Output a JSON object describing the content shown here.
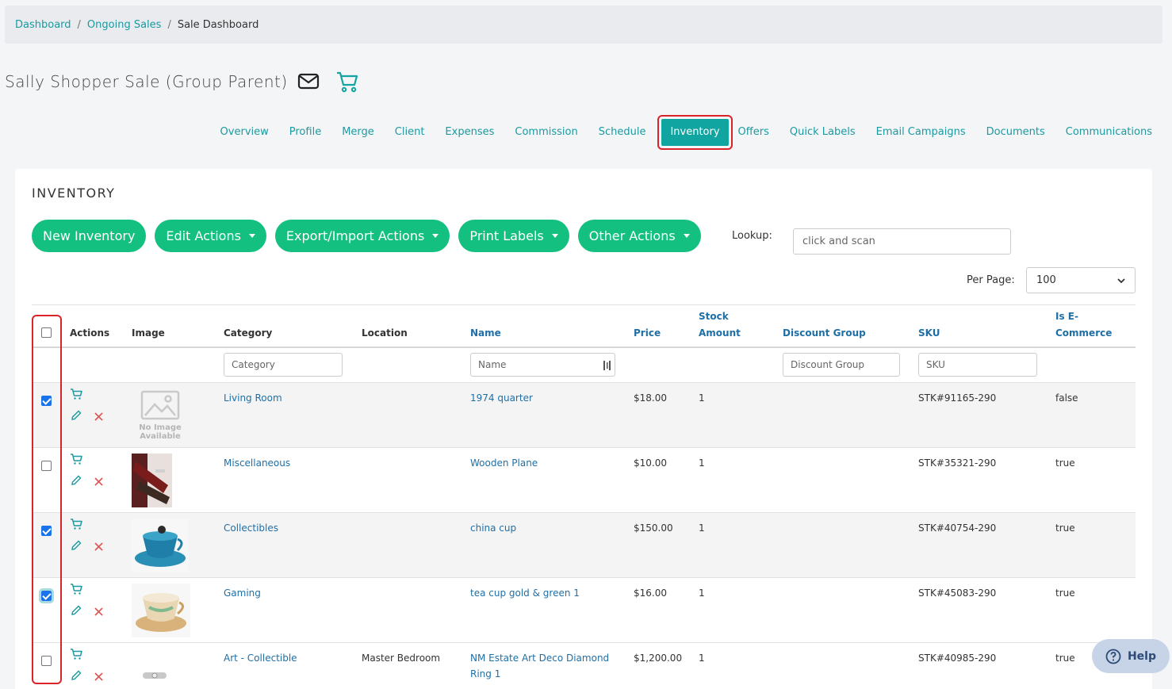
{
  "breadcrumb": {
    "items": [
      "Dashboard",
      "Ongoing Sales",
      "Sale Dashboard"
    ],
    "separator": "/"
  },
  "header": {
    "title": "Sally Shopper Sale (Group Parent)",
    "icons": [
      "mail-icon",
      "cart-icon"
    ]
  },
  "tabs": [
    "Overview",
    "Profile",
    "Merge",
    "Client",
    "Expenses",
    "Commission",
    "Schedule",
    "Inventory",
    "Offers",
    "Quick Labels",
    "Email Campaigns",
    "Documents",
    "Communications"
  ],
  "active_tab": "Inventory",
  "inventory": {
    "section_title": "INVENTORY",
    "buttons": {
      "new": "New Inventory",
      "edit": "Edit Actions",
      "export": "Export/Import Actions",
      "print": "Print Labels",
      "other": "Other Actions"
    },
    "lookup": {
      "label": "Lookup:",
      "placeholder": "click and scan"
    },
    "per_page": {
      "label": "Per Page:",
      "value": "100"
    },
    "columns": {
      "actions": "Actions",
      "image": "Image",
      "category": "Category",
      "location": "Location",
      "name": "Name",
      "price": "Price",
      "stock_line1": "Stock",
      "stock_line2": "Amount",
      "discount_group": "Discount Group",
      "sku": "SKU",
      "ecommerce_line1": "Is E-",
      "ecommerce_line2": "Commerce"
    },
    "filters": {
      "category": "Category",
      "name": "Name",
      "discount_group": "Discount Group",
      "sku": "SKU"
    },
    "no_image": {
      "line1": "No Image",
      "line2": "Available"
    },
    "rows": [
      {
        "checked": true,
        "category": "Living Room",
        "location": "",
        "name_line1": "1974 quarter",
        "name_line2": "",
        "price": "$18.00",
        "stock": "1",
        "discount_group": "",
        "sku": "STK#91165-290",
        "ecommerce": "false",
        "image": "no-image"
      },
      {
        "checked": false,
        "category": "Miscellaneous",
        "location": "",
        "name_line1": "Wooden Plane",
        "name_line2": "",
        "price": "$10.00",
        "stock": "1",
        "discount_group": "",
        "sku": "STK#35321-290",
        "ecommerce": "true",
        "image": "wooden-plane-photo"
      },
      {
        "checked": true,
        "category": "Collectibles",
        "location": "",
        "name_line1": "china cup",
        "name_line2": "",
        "price": "$150.00",
        "stock": "1",
        "discount_group": "",
        "sku": "STK#40754-290",
        "ecommerce": "true",
        "image": "china-cup-photo"
      },
      {
        "checked": true,
        "category": "Gaming",
        "location": "",
        "name_line1": "tea cup gold & green 1",
        "name_line2": "",
        "price": "$16.00",
        "stock": "1",
        "discount_group": "",
        "sku": "STK#45083-290",
        "ecommerce": "true",
        "image": "tea-cup-photo"
      },
      {
        "checked": false,
        "category": "Art - Collectible",
        "location": "Master Bedroom",
        "name_line1": "NM Estate Art Deco Diamond",
        "name_line2": "Ring 1",
        "price": "$1,200.00",
        "stock": "1",
        "discount_group": "",
        "sku": "STK#40985-290",
        "ecommerce": "true",
        "image": "ring-photo"
      }
    ]
  },
  "help": {
    "label": "Help"
  },
  "colors": {
    "teal": "#1a9aa0",
    "active_tab": "#10a5a0",
    "green_button": "#13c07f",
    "highlight": "#d9242a",
    "link_blue": "#1f6fa7",
    "delete_red": "#e05050"
  }
}
